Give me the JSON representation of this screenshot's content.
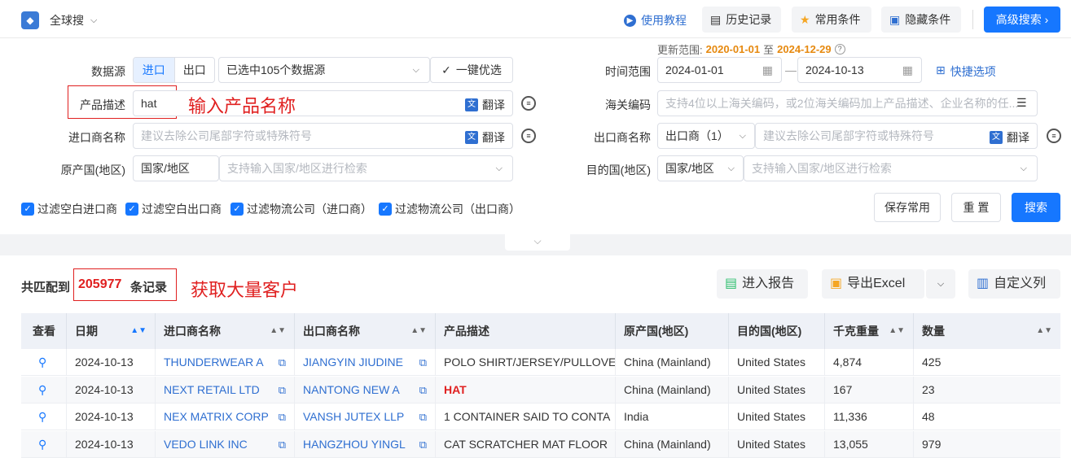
{
  "app": {
    "title": "全球搜"
  },
  "toolbar": {
    "tutorial": "使用教程",
    "history": "历史记录",
    "common": "常用条件",
    "hidden": "隐藏条件",
    "advanced": "高级搜索"
  },
  "update_range": {
    "label": "更新范围:",
    "start": "2020-01-01",
    "sep": "至",
    "end": "2024-12-29"
  },
  "form": {
    "data_source": {
      "label": "数据源",
      "tab_import": "进口",
      "tab_export": "出口",
      "selected": "已选中105个数据源",
      "one_click": "一键优选"
    },
    "time_range": {
      "label": "时间范围",
      "start": "2024-01-01",
      "end": "2024-10-13",
      "sep": "—",
      "quick": "快捷选项"
    },
    "product": {
      "label": "产品描述",
      "value": "hat",
      "translate": "翻译",
      "annotation": "输入产品名称"
    },
    "hs_code": {
      "label": "海关编码",
      "placeholder": "支持4位以上海关编码，或2位海关编码加上产品描述、企业名称的任..."
    },
    "importer": {
      "label": "进口商名称",
      "placeholder": "建议去除公司尾部字符或特殊符号",
      "translate": "翻译"
    },
    "exporter": {
      "label": "出口商名称",
      "select": "出口商（1）",
      "placeholder": "建议去除公司尾部字符或特殊符号",
      "translate": "翻译"
    },
    "origin": {
      "label": "原产国(地区)",
      "select": "国家/地区",
      "placeholder": "支持输入国家/地区进行检索"
    },
    "destination": {
      "label": "目的国(地区)",
      "select": "国家/地区",
      "placeholder": "支持输入国家/地区进行检索"
    },
    "filters": [
      "过滤空白进口商",
      "过滤空白出口商",
      "过滤物流公司（进口商）",
      "过滤物流公司（出口商）"
    ],
    "save": "保存常用",
    "reset": "重 置",
    "search": "搜索"
  },
  "results": {
    "prefix": "共匹配到",
    "count": "205977",
    "suffix": "条记录",
    "annotation": "获取大量客户",
    "report": "进入报告",
    "export": "导出Excel",
    "custom": "自定义列"
  },
  "table": {
    "headers": [
      "查看",
      "日期",
      "进口商名称",
      "出口商名称",
      "产品描述",
      "原产国(地区)",
      "目的国(地区)",
      "千克重量",
      "数量"
    ],
    "rows": [
      [
        "2024-10-13",
        "THUNDERWEAR A",
        "JIANGYIN JIUDINE",
        "POLO SHIRT/JERSEY/PULLOVE",
        "China (Mainland)",
        "United States",
        "4,874",
        "425"
      ],
      [
        "2024-10-13",
        "NEXT RETAIL LTD",
        "NANTONG NEW A",
        "HAT",
        "China (Mainland)",
        "United States",
        "167",
        "23"
      ],
      [
        "2024-10-13",
        "NEX MATRIX CORP",
        "VANSH JUTEX LLP",
        "1 CONTAINER SAID TO CONTA",
        "India",
        "United States",
        "11,336",
        "48"
      ],
      [
        "2024-10-13",
        "VEDO LINK INC",
        "HANGZHOU YINGL",
        "CAT SCRATCHER MAT FLOOR",
        "China (Mainland)",
        "United States",
        "13,055",
        "979"
      ]
    ]
  },
  "colors": {
    "accent": "#1677ff",
    "highlight": "#e02020",
    "orange": "#e6890f"
  }
}
